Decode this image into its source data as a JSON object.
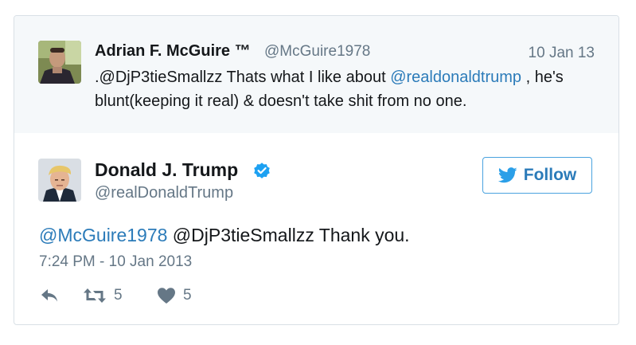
{
  "parent_tweet": {
    "author_name": "Adrian F. McGuire ™",
    "author_handle": "@McGuire1978",
    "date": "10 Jan 13",
    "text_part1": ".@DjP3tieSmallzz Thats what I like about ",
    "mention": "@realdonaldtrump",
    "text_part2": " , he's blunt(keeping it real) & doesn't take shit from no one."
  },
  "main_tweet": {
    "author_name": "Donald J. Trump",
    "author_handle": "@realDonaldTrump",
    "follow_label": "Follow",
    "mention_link": "@McGuire1978",
    "text_rest": " @DjP3tieSmallzz Thank you.",
    "timestamp": "7:24 PM - 10 Jan 2013",
    "retweet_count": "5",
    "like_count": "5"
  },
  "colors": {
    "link": "#2b7bb9",
    "secondary_text": "#657786",
    "parent_background": "#f5f8fa",
    "verified_badge": "#1da1f2"
  },
  "icons": [
    "reply-icon",
    "retweet-icon",
    "heart-icon",
    "verified-badge-icon",
    "twitter-bird-icon"
  ]
}
